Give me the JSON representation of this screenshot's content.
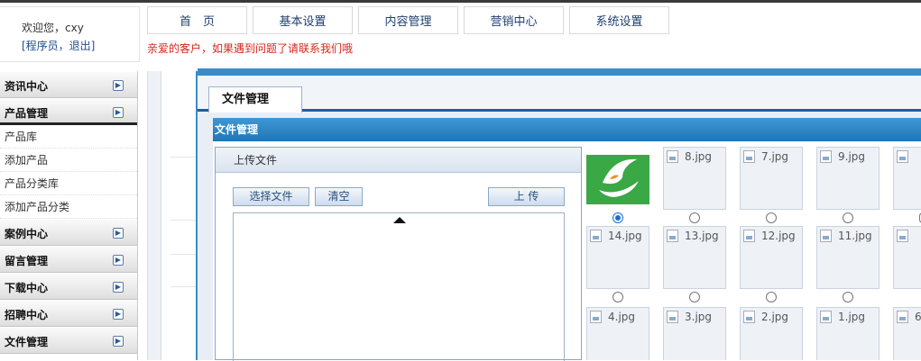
{
  "header": {
    "welcome": "欢迎您，cxy",
    "role_links": "[程序员，退出]",
    "notice": "亲爱的客户，如果遇到问题了请联系我们哦"
  },
  "nav": [
    {
      "label": "首　页"
    },
    {
      "label": "基本设置"
    },
    {
      "label": "内容管理"
    },
    {
      "label": "营销中心"
    },
    {
      "label": "系统设置"
    }
  ],
  "sidebar": {
    "toggle_glyph": "▶",
    "groups": [
      {
        "label": "资讯中心",
        "open": false
      },
      {
        "label": "产品管理",
        "open": true,
        "items": [
          "产品库",
          "添加产品",
          "产品分类库",
          "添加产品分类"
        ]
      },
      {
        "label": "案例中心",
        "open": false
      },
      {
        "label": "留言管理",
        "open": false
      },
      {
        "label": "下载中心",
        "open": false
      },
      {
        "label": "招聘中心",
        "open": false
      },
      {
        "label": "文件管理",
        "open": false
      }
    ]
  },
  "panel": {
    "tab_label": "文件管理",
    "section_title": "文件管理"
  },
  "upload": {
    "title": "上传文件",
    "choose_label": "选择文件",
    "clear_label": "清空",
    "upload_label": "上 传"
  },
  "gallery": {
    "selected_index": 0,
    "files": [
      "",
      "8.jpg",
      "7.jpg",
      "9.jpg",
      "",
      "14.jpg",
      "13.jpg",
      "12.jpg",
      "11.jpg",
      "",
      "4.jpg",
      "3.jpg",
      "2.jpg",
      "1.jpg",
      "6"
    ]
  },
  "colors": {
    "accent": "#3a8cc8",
    "notice": "#d8261c",
    "nav_text": "#1f3f6f"
  }
}
